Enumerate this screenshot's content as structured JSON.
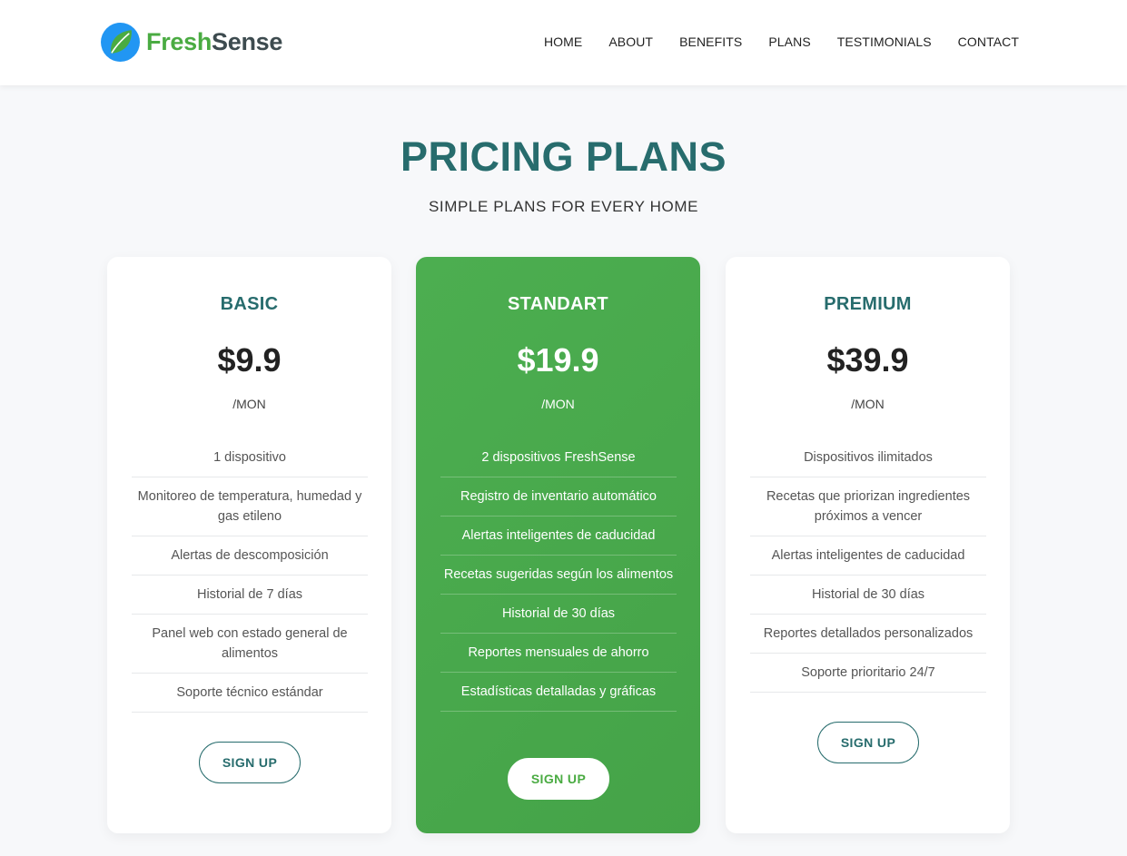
{
  "brand": {
    "fresh": "Fresh",
    "sense": "Sense",
    "icon": "leaf-logo-icon",
    "colors": {
      "green": "#4aab42",
      "blue": "#2196f3",
      "dark": "#3d4b4f"
    }
  },
  "nav": {
    "items": [
      "HOME",
      "ABOUT",
      "BENEFITS",
      "PLANS",
      "TESTIMONIALS",
      "CONTACT"
    ]
  },
  "section": {
    "title": "PRICING PLANS",
    "subtitle": "SIMPLE PLANS FOR EVERY HOME",
    "title_color": "#276c6d"
  },
  "plans": [
    {
      "name": "BASIC",
      "price": "$9.9",
      "period": "/MON",
      "features": [
        "1 dispositivo",
        "Monitoreo de temperatura, humedad y gas etileno",
        "Alertas de descomposición",
        "Historial de 7 días",
        "Panel web con estado general de alimentos",
        "Soporte técnico estándar"
      ],
      "cta": "SIGN UP"
    },
    {
      "name": "STANDART",
      "price": "$19.9",
      "period": "/MON",
      "features": [
        "2 dispositivos FreshSense",
        "Registro de inventario automático",
        "Alertas inteligentes de caducidad",
        "Recetas sugeridas según los alimentos",
        "Historial de 30 días",
        "Reportes mensuales de ahorro",
        "Estadísticas detalladas y gráficas"
      ],
      "cta": "SIGN UP",
      "highlight_color": "#4aab42"
    },
    {
      "name": "PREMIUM",
      "price": "$39.9",
      "period": "/MON",
      "features": [
        "Dispositivos ilimitados",
        "Recetas que priorizan ingredientes próximos a vencer",
        "Alertas inteligentes de caducidad",
        "Historial de 30 días",
        "Reportes detallados personalizados",
        "Soporte prioritario 24/7"
      ],
      "cta": "SIGN UP"
    }
  ]
}
